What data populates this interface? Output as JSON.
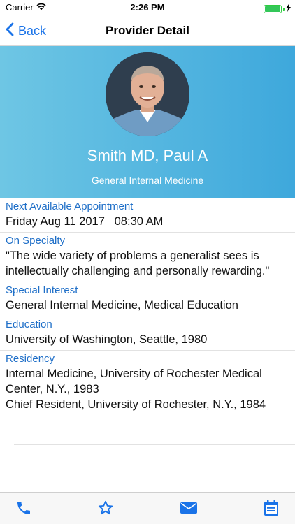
{
  "status_bar": {
    "carrier": "Carrier",
    "time": "2:26 PM",
    "battery_level": 1.0,
    "battery_color": "#34c759"
  },
  "nav": {
    "back_label": "Back",
    "title": "Provider Detail"
  },
  "provider": {
    "name": "Smith MD, Paul A",
    "specialty": "General Internal Medicine"
  },
  "sections": [
    {
      "label": "Next Available Appointment",
      "lines": [
        "Friday Aug 11 2017   08:30 AM"
      ]
    },
    {
      "label": "On Specialty",
      "lines": [
        "\"The wide variety of problems a generalist sees is intellectually challenging and personally rewarding.\""
      ]
    },
    {
      "label": "Special Interest",
      "lines": [
        "General Internal Medicine, Medical Education"
      ]
    },
    {
      "label": "Education",
      "lines": [
        "University of Washington, Seattle, 1980"
      ]
    },
    {
      "label": "Residency",
      "lines": [
        "Internal Medicine, University of Rochester Medical Center, N.Y., 1983",
        "Chief Resident, University of Rochester, N.Y., 1984"
      ]
    }
  ],
  "tab_bar": {
    "icons": [
      "phone-icon",
      "star-icon",
      "mail-icon",
      "calendar-icon"
    ]
  },
  "colors": {
    "accent": "#1a73e8",
    "label_blue": "#1f6fc8",
    "hero_start": "#6ec6e4",
    "hero_end": "#3ea8dc"
  }
}
